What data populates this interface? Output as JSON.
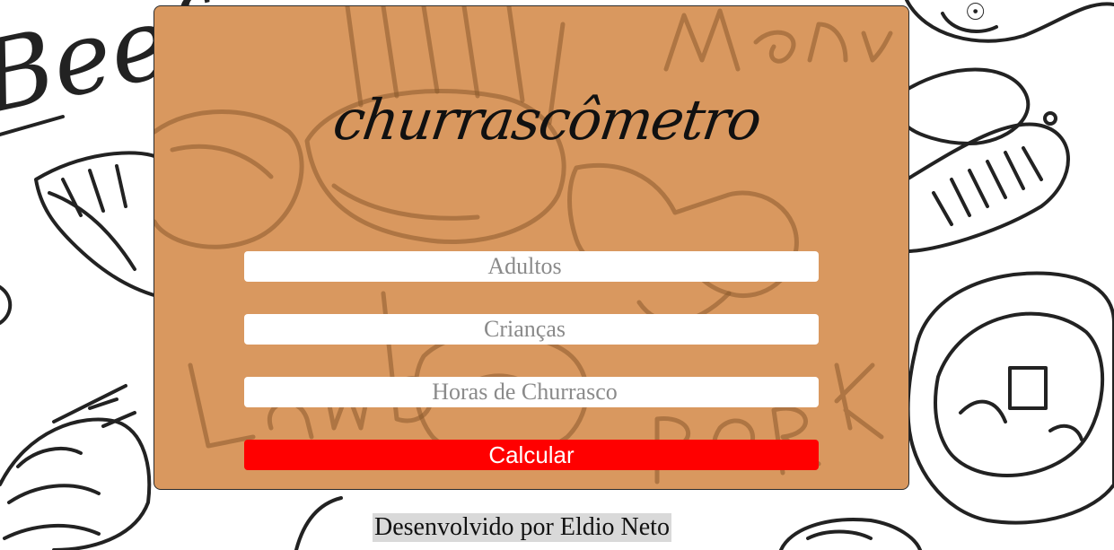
{
  "page": {
    "logo_text": "churrascômetro",
    "background_words": [
      "Beef",
      "Menu",
      "Lamb",
      "PORK"
    ]
  },
  "form": {
    "adults_placeholder": "Adultos",
    "kids_placeholder": "Crianças",
    "hours_placeholder": "Horas de Churrasco",
    "calculate_label": "Calcular"
  },
  "footer": {
    "credit": "Desenvolvido por Eldio Neto"
  },
  "colors": {
    "card_background": "#d9985f",
    "button_background": "#ff0000",
    "button_text": "#ffffff",
    "footer_background": "#d9d9d9"
  }
}
